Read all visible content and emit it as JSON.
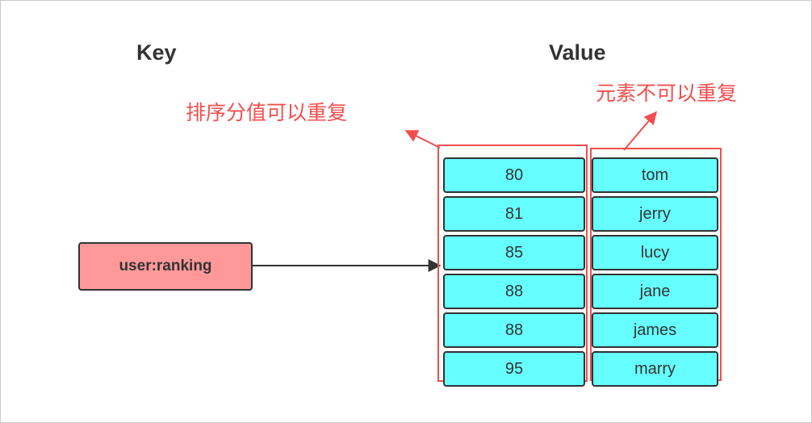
{
  "headings": {
    "key": "Key",
    "value": "Value"
  },
  "notes": {
    "score": "排序分值可以重复",
    "member": "元素不可以重复"
  },
  "key_box": {
    "label": "user:ranking"
  },
  "zset": {
    "rows": [
      {
        "score": "80",
        "member": "tom"
      },
      {
        "score": "81",
        "member": "jerry"
      },
      {
        "score": "85",
        "member": "lucy"
      },
      {
        "score": "88",
        "member": "jane"
      },
      {
        "score": "88",
        "member": "james"
      },
      {
        "score": "95",
        "member": "marry"
      }
    ]
  },
  "colors": {
    "key_fill": "#ff9999",
    "cell_fill": "#66ffff",
    "annotation": "#f24e4e",
    "stroke": "#333333"
  }
}
